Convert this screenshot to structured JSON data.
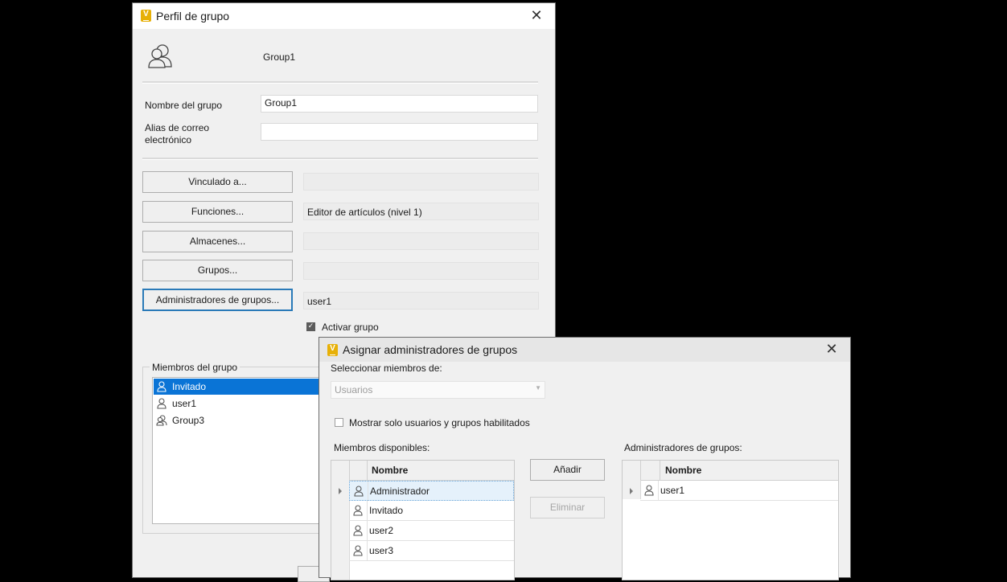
{
  "group_profile": {
    "title": "Perfil de grupo",
    "group_name_display": "Group1",
    "name_label": "Nombre del grupo",
    "name_value": "Group1",
    "email_label": "Alias de correo electrónico",
    "email_value": "",
    "buttons": [
      {
        "label": "Vinculado a...",
        "value": ""
      },
      {
        "label": "Funciones...",
        "value": "Editor de artículos (nivel 1)"
      },
      {
        "label": "Almacenes...",
        "value": ""
      },
      {
        "label": "Grupos...",
        "value": ""
      },
      {
        "label": "Administradores de grupos...",
        "value": "user1"
      }
    ],
    "activate_label": "Activar grupo",
    "activate_checked": true,
    "members_label": "Miembros del grupo",
    "members": [
      {
        "name": "Invitado",
        "icon": "user-icon",
        "selected": true
      },
      {
        "name": "user1",
        "icon": "user-icon",
        "selected": false
      },
      {
        "name": "Group3",
        "icon": "group-icon",
        "selected": false
      }
    ]
  },
  "assign_admins": {
    "title": "Asignar administradores de grupos",
    "select_members_label": "Seleccionar miembros de:",
    "select_value": "Usuarios",
    "show_only_label": "Mostrar solo usuarios y grupos habilitados",
    "show_only_checked": false,
    "available_label": "Miembros disponibles:",
    "admins_label": "Administradores de grupos:",
    "name_column": "Nombre",
    "add_button": "Añadir",
    "remove_button": "Eliminar",
    "available": [
      "Administrador",
      "Invitado",
      "user2",
      "user3"
    ],
    "admins": [
      "user1"
    ]
  },
  "colors": {
    "accent": "#0a74d6",
    "app_icon": "#e7b007",
    "focus_border": "#2a7ab8"
  }
}
